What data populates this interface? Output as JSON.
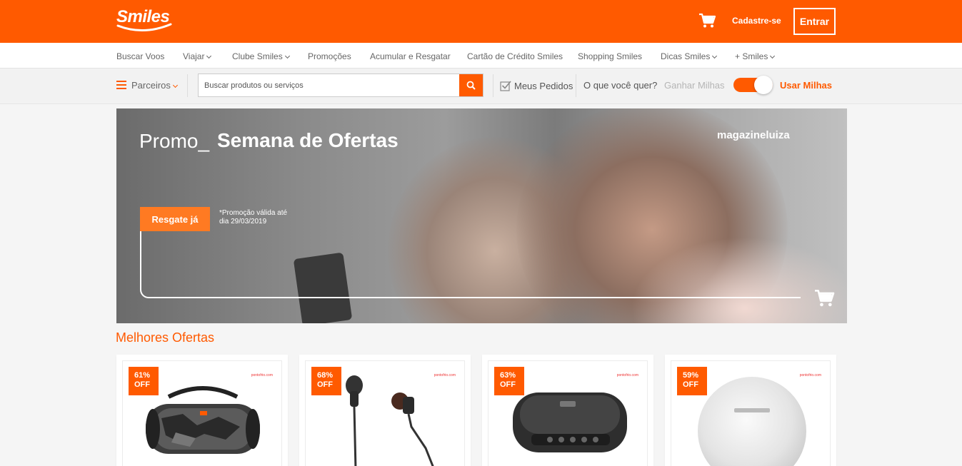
{
  "header": {
    "logo_text": "Smiles",
    "signup_label": "Cadastre-se",
    "login_label": "Entrar",
    "brand_color": "#ff5a00"
  },
  "nav": {
    "items": [
      {
        "label": "Buscar Voos",
        "dropdown": false
      },
      {
        "label": "Viajar",
        "dropdown": true
      },
      {
        "label": "Clube Smiles",
        "dropdown": true
      },
      {
        "label": "Promoções",
        "dropdown": false
      },
      {
        "label": "Acumular e Resgatar",
        "dropdown": false
      },
      {
        "label": "Cartão de Crédito Smiles",
        "dropdown": false
      },
      {
        "label": "Shopping Smiles",
        "dropdown": false
      },
      {
        "label": "Dicas Smiles",
        "dropdown": true
      },
      {
        "label": "+ Smiles",
        "dropdown": true
      }
    ]
  },
  "shopbar": {
    "partners_label": "Parceiros",
    "search_placeholder": "Buscar produtos ou serviços",
    "orders_label": "Meus Pedidos",
    "question_label": "O que você quer?",
    "earn_label": "Ganhar Milhas",
    "use_label": "Usar Milhas",
    "toggle_on": true
  },
  "banner": {
    "promo_label": "Promo_",
    "title": "Semana de Ofertas",
    "brand": "magazineluiza",
    "cta_label": "Resgate já",
    "note": "*Promoção válida até dia 29/03/2019"
  },
  "offers": {
    "title": "Melhores Ofertas",
    "items": [
      {
        "discount": "61%",
        "off": "OFF",
        "store": "pontofrio.com",
        "product": "speaker-boombox"
      },
      {
        "discount": "68%",
        "off": "OFF",
        "store": "pontofrio.com",
        "product": "earphones"
      },
      {
        "discount": "63%",
        "off": "OFF",
        "store": "pontofrio.com",
        "product": "speakerphone"
      },
      {
        "discount": "59%",
        "off": "OFF",
        "store": "pontofrio.com",
        "product": "round-speaker"
      }
    ]
  }
}
